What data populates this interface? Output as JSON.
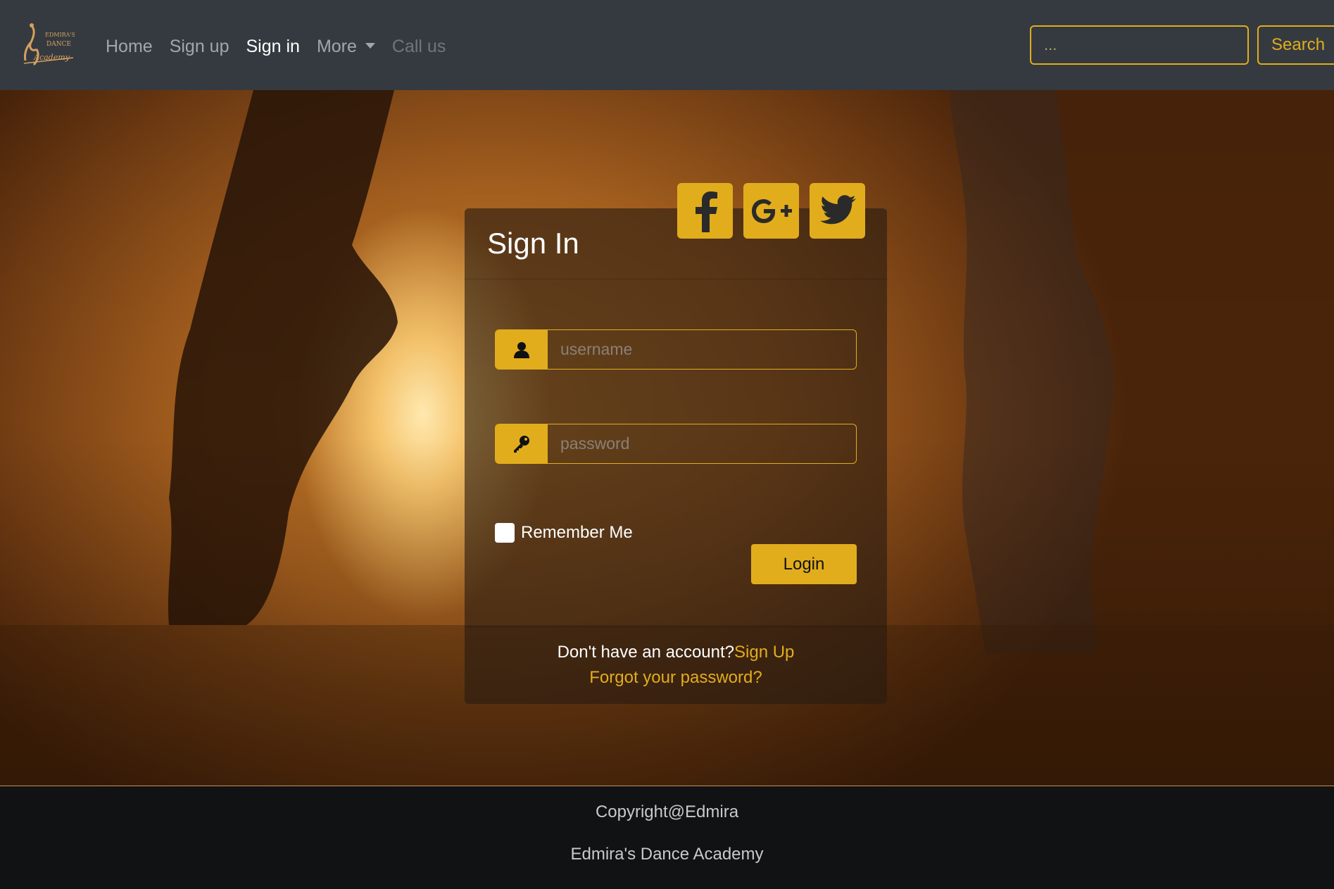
{
  "navbar": {
    "brand": "EDMIRA'S DANCE Academy",
    "links": {
      "home": "Home",
      "signup": "Sign up",
      "signin": "Sign in",
      "more": "More",
      "callus": "Call us"
    },
    "search": {
      "placeholder": "...",
      "button": "Search"
    }
  },
  "login": {
    "title": "Sign In",
    "social": [
      "facebook-icon",
      "google-plus-icon",
      "twitter-icon"
    ],
    "username_placeholder": "username",
    "password_placeholder": "password",
    "remember_label": "Remember Me",
    "login_button": "Login",
    "no_account_text": "Don't have an account?",
    "signup_link": "Sign Up",
    "forgot_link": "Forgot your password?"
  },
  "footer": {
    "copyright": "Copyright@Edmira",
    "academy": "Edmira's Dance Academy"
  },
  "colors": {
    "accent": "#e2ad1c",
    "navbar_bg": "#343a40",
    "footer_bg": "#111214"
  }
}
